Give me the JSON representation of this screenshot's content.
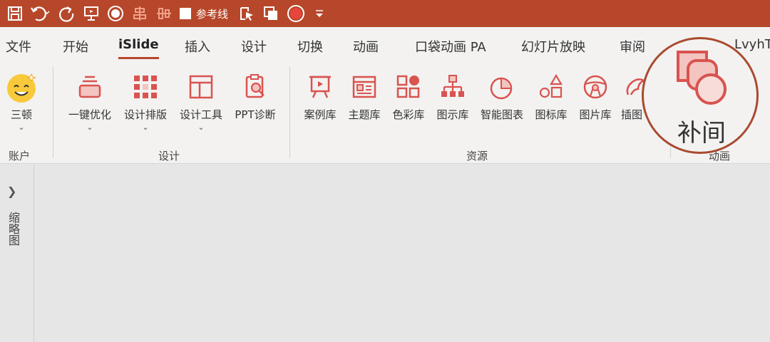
{
  "qat": {
    "guides_label": "参考线"
  },
  "tabs": [
    {
      "label": "文件"
    },
    {
      "label": "开始"
    },
    {
      "label": "iSlide"
    },
    {
      "label": "插入"
    },
    {
      "label": "设计"
    },
    {
      "label": "切换"
    },
    {
      "label": "动画"
    },
    {
      "label": "口袋动画 PA"
    },
    {
      "label": "幻灯片放映"
    },
    {
      "label": "审阅"
    },
    {
      "label": "LvyhT"
    }
  ],
  "ribbon": {
    "account_btn": "三顿",
    "account_group": "账户",
    "design_buttons": [
      "一键优化",
      "设计排版",
      "设计工具",
      "PPT诊断"
    ],
    "design_group": "设计",
    "resource_buttons": [
      "案例库",
      "主题库",
      "色彩库",
      "图示库",
      "智能图表",
      "图标库",
      "图片库",
      "插图"
    ],
    "resource_group": "资源",
    "anim_btn": "补间",
    "anim_group": "动画"
  },
  "thumbnail_pane": {
    "label": "缩略图"
  },
  "colors": {
    "accent": "#b7472a",
    "icon_red": "#d9534f"
  }
}
